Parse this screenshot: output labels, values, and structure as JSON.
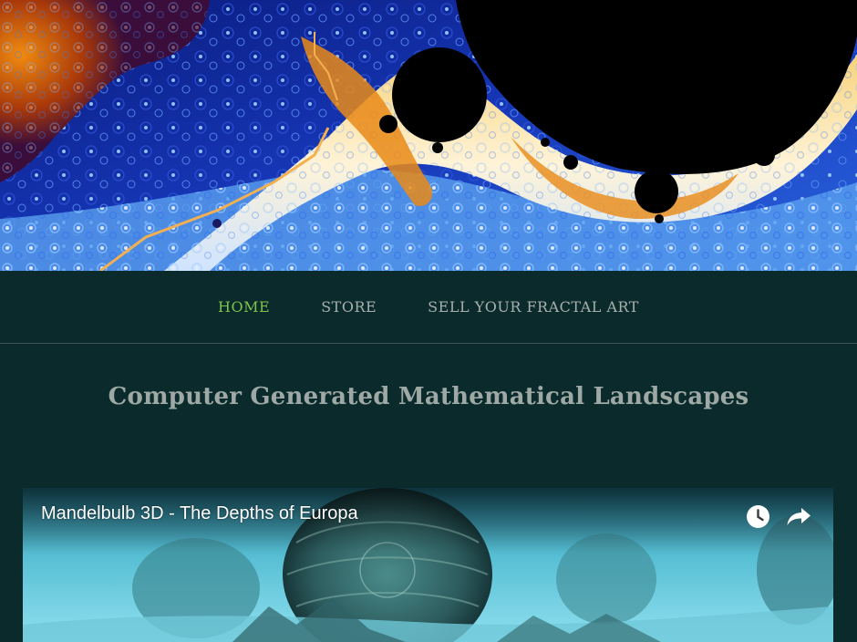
{
  "nav": {
    "items": [
      {
        "label": "HOME",
        "active": true
      },
      {
        "label": "STORE",
        "active": false
      },
      {
        "label": "SELL YOUR FRACTAL ART",
        "active": false
      }
    ],
    "active_color": "#7fc34a",
    "inactive_color": "#a8b0ad"
  },
  "main": {
    "title": "Computer Generated Mathematical Landscapes"
  },
  "video": {
    "title": "Mandelbulb 3D - The Depths of Europa",
    "icons": [
      "watch-later-icon",
      "share-icon"
    ]
  },
  "colors": {
    "background": "#0a2a2c",
    "title": "#9ea9a5"
  }
}
